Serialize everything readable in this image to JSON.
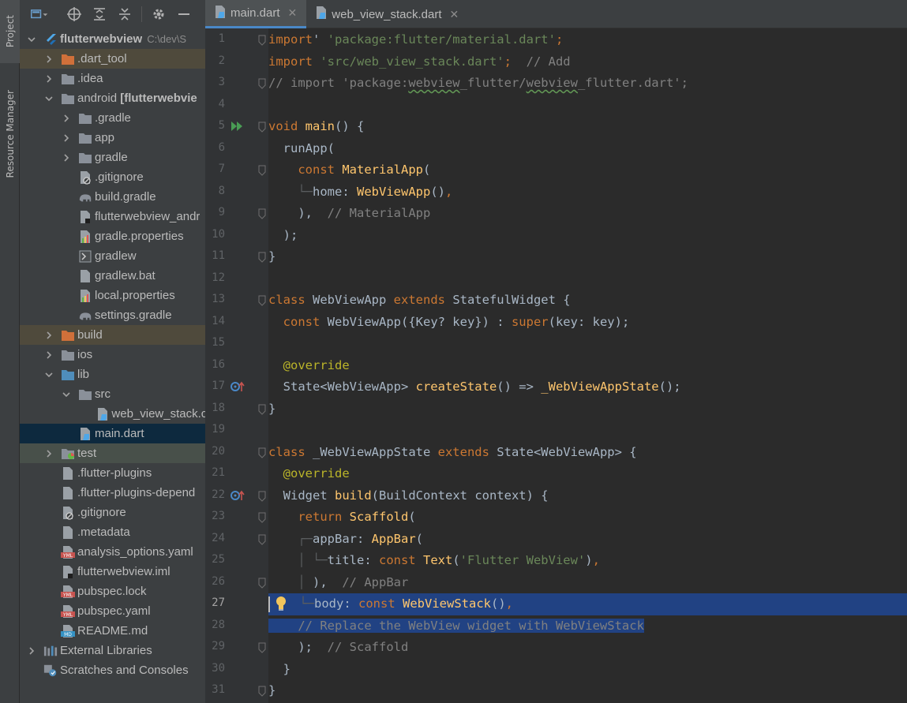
{
  "tool_strip": {
    "project_label": "Project",
    "resource_label": "Resource Manager"
  },
  "tree": [
    {
      "label": "flutterwebview",
      "hint": "C:\\dev\\S",
      "indent": 0,
      "arrow": "down",
      "icon": "flutter-module",
      "bold": true
    },
    {
      "label": ".dart_tool",
      "indent": 1,
      "arrow": "right",
      "icon": "folder-orange",
      "bg": "excluded"
    },
    {
      "label": ".idea",
      "indent": 1,
      "arrow": "right",
      "icon": "folder"
    },
    {
      "label": "android [flutterwebvie",
      "indent": 1,
      "arrow": "down",
      "icon": "folder",
      "bold_suffix": true
    },
    {
      "label": ".gradle",
      "indent": 2,
      "arrow": "right",
      "icon": "folder"
    },
    {
      "label": "app",
      "indent": 2,
      "arrow": "right",
      "icon": "folder"
    },
    {
      "label": "gradle",
      "indent": 2,
      "arrow": "right",
      "icon": "folder"
    },
    {
      "label": ".gitignore",
      "indent": 2,
      "arrow": "",
      "icon": "gitignore"
    },
    {
      "label": "build.gradle",
      "indent": 2,
      "arrow": "",
      "icon": "gradle-elephant"
    },
    {
      "label": "flutterwebview_andr",
      "indent": 2,
      "arrow": "",
      "icon": "file-dark"
    },
    {
      "label": "gradle.properties",
      "indent": 2,
      "arrow": "",
      "icon": "properties"
    },
    {
      "label": "gradlew",
      "indent": 2,
      "arrow": "",
      "icon": "shell"
    },
    {
      "label": "gradlew.bat",
      "indent": 2,
      "arrow": "",
      "icon": "file"
    },
    {
      "label": "local.properties",
      "indent": 2,
      "arrow": "",
      "icon": "properties"
    },
    {
      "label": "settings.gradle",
      "indent": 2,
      "arrow": "",
      "icon": "gradle-elephant"
    },
    {
      "label": "build",
      "indent": 1,
      "arrow": "right",
      "icon": "folder-orange",
      "bg": "excluded"
    },
    {
      "label": "ios",
      "indent": 1,
      "arrow": "right",
      "icon": "folder"
    },
    {
      "label": "lib",
      "indent": 1,
      "arrow": "down",
      "icon": "folder-blue"
    },
    {
      "label": "src",
      "indent": 2,
      "arrow": "down",
      "icon": "folder"
    },
    {
      "label": "web_view_stack.c",
      "indent": 3,
      "arrow": "",
      "icon": "dart"
    },
    {
      "label": "main.dart",
      "indent": 2,
      "arrow": "",
      "icon": "dart",
      "bg": "selected"
    },
    {
      "label": "test",
      "indent": 1,
      "arrow": "right",
      "icon": "folder-test",
      "bg": "test-bg"
    },
    {
      "label": ".flutter-plugins",
      "indent": 1,
      "arrow": "",
      "icon": "file"
    },
    {
      "label": ".flutter-plugins-depend",
      "indent": 1,
      "arrow": "",
      "icon": "file"
    },
    {
      "label": ".gitignore",
      "indent": 1,
      "arrow": "",
      "icon": "gitignore"
    },
    {
      "label": ".metadata",
      "indent": 1,
      "arrow": "",
      "icon": "file"
    },
    {
      "label": "analysis_options.yaml",
      "indent": 1,
      "arrow": "",
      "icon": "yml"
    },
    {
      "label": "flutterwebview.iml",
      "indent": 1,
      "arrow": "",
      "icon": "file-dark"
    },
    {
      "label": "pubspec.lock",
      "indent": 1,
      "arrow": "",
      "icon": "yml"
    },
    {
      "label": "pubspec.yaml",
      "indent": 1,
      "arrow": "",
      "icon": "yml"
    },
    {
      "label": "README.md",
      "indent": 1,
      "arrow": "",
      "icon": "md"
    },
    {
      "label": "External Libraries",
      "indent": 0,
      "arrow": "right",
      "icon": "libraries"
    },
    {
      "label": "Scratches and Consoles",
      "indent": 0,
      "arrow": "",
      "icon": "scratches"
    }
  ],
  "tabs": [
    {
      "label": "main.dart",
      "active": true
    },
    {
      "label": "web_view_stack.dart",
      "active": false
    }
  ],
  "code_lines": [
    {
      "n": "1",
      "fold": true,
      "tokens": [
        [
          "kw",
          "import"
        ],
        [
          "",
          "' "
        ],
        [
          "str",
          "'package:flutter/material.dart'"
        ],
        [
          "kw",
          ";"
        ]
      ]
    },
    {
      "n": "2",
      "tokens": [
        [
          "kw",
          "import "
        ],
        [
          "str",
          "'src/web_view_stack.dart'"
        ],
        [
          "kw",
          ";"
        ],
        [
          "cmt",
          "  // Add"
        ]
      ]
    },
    {
      "n": "3",
      "fold": true,
      "tokens": [
        [
          "cmt",
          "// import 'package:"
        ],
        [
          "cmt typo",
          "webview"
        ],
        [
          "cmt",
          "_flutter/"
        ],
        [
          "cmt typo",
          "webview"
        ],
        [
          "cmt",
          "_flutter.dart';"
        ]
      ]
    },
    {
      "n": "4",
      "tokens": []
    },
    {
      "n": "5",
      "fold": true,
      "mark": "run",
      "tokens": [
        [
          "kw",
          "void "
        ],
        [
          "fn",
          "main"
        ],
        [
          "",
          "() {"
        ]
      ]
    },
    {
      "n": "6",
      "tokens": [
        [
          "",
          "  runApp("
        ]
      ]
    },
    {
      "n": "7",
      "fold": true,
      "tokens": [
        [
          "",
          "    "
        ],
        [
          "kw",
          "const "
        ],
        [
          "fn",
          "MaterialApp"
        ],
        [
          "",
          "("
        ]
      ]
    },
    {
      "n": "8",
      "tokens": [
        [
          "guide",
          "    └─"
        ],
        [
          "",
          "home: "
        ],
        [
          "fn",
          "WebViewApp"
        ],
        [
          "",
          "()"
        ],
        [
          "kw",
          ","
        ]
      ]
    },
    {
      "n": "9",
      "fold": true,
      "tokens": [
        [
          "",
          "    ),"
        ],
        [
          "cmt",
          "  // MaterialApp"
        ]
      ]
    },
    {
      "n": "10",
      "tokens": [
        [
          "",
          "  );"
        ]
      ]
    },
    {
      "n": "11",
      "fold": true,
      "tokens": [
        [
          "",
          "}"
        ]
      ]
    },
    {
      "n": "12",
      "tokens": []
    },
    {
      "n": "13",
      "fold": true,
      "tokens": [
        [
          "kw",
          "class "
        ],
        [
          "",
          "WebViewApp "
        ],
        [
          "kw",
          "extends "
        ],
        [
          "",
          "StatefulWidget {"
        ]
      ]
    },
    {
      "n": "14",
      "tokens": [
        [
          "",
          "  "
        ],
        [
          "kw",
          "const "
        ],
        [
          "",
          "WebViewApp({Key? key}) : "
        ],
        [
          "kw",
          "super"
        ],
        [
          "",
          "(key: key);"
        ]
      ]
    },
    {
      "n": "15",
      "tokens": []
    },
    {
      "n": "16",
      "tokens": [
        [
          "",
          "  "
        ],
        [
          "ann",
          "@override"
        ]
      ]
    },
    {
      "n": "17",
      "mark": "override",
      "tokens": [
        [
          "",
          "  State<WebViewApp> "
        ],
        [
          "fn",
          "createState"
        ],
        [
          "",
          "() => "
        ],
        [
          "fn",
          "_WebViewAppState"
        ],
        [
          "",
          "();"
        ]
      ]
    },
    {
      "n": "18",
      "fold": true,
      "tokens": [
        [
          "",
          "}"
        ]
      ]
    },
    {
      "n": "19",
      "tokens": []
    },
    {
      "n": "20",
      "fold": true,
      "tokens": [
        [
          "kw",
          "class "
        ],
        [
          "",
          "_WebViewAppState "
        ],
        [
          "kw",
          "extends "
        ],
        [
          "",
          "State<WebViewApp> {"
        ]
      ]
    },
    {
      "n": "21",
      "tokens": [
        [
          "",
          "  "
        ],
        [
          "ann",
          "@override"
        ]
      ]
    },
    {
      "n": "22",
      "mark": "override",
      "fold": true,
      "tokens": [
        [
          "",
          "  Widget "
        ],
        [
          "fn",
          "build"
        ],
        [
          "",
          "(BuildContext context) {"
        ]
      ]
    },
    {
      "n": "23",
      "fold": true,
      "tokens": [
        [
          "",
          "    "
        ],
        [
          "kw",
          "return "
        ],
        [
          "fn",
          "Scaffold"
        ],
        [
          "",
          "("
        ]
      ]
    },
    {
      "n": "24",
      "fold": true,
      "tokens": [
        [
          "guide",
          "    ┌─"
        ],
        [
          "",
          "appBar: "
        ],
        [
          "fn",
          "AppBar"
        ],
        [
          "",
          "("
        ]
      ]
    },
    {
      "n": "25",
      "tokens": [
        [
          "guide",
          "    │ └─"
        ],
        [
          "",
          "title: "
        ],
        [
          "kw",
          "const "
        ],
        [
          "fn",
          "Text"
        ],
        [
          "",
          "("
        ],
        [
          "str",
          "'Flutter WebView'"
        ],
        [
          "",
          ")"
        ],
        [
          "kw",
          ","
        ]
      ]
    },
    {
      "n": "26",
      "fold": true,
      "tokens": [
        [
          "guide",
          "    │ "
        ],
        [
          "",
          "),"
        ],
        [
          "cmt",
          "  // AppBar"
        ]
      ]
    },
    {
      "n": "27",
      "selected": true,
      "tokens": [
        [
          "guide",
          "    └─"
        ],
        [
          "",
          "body: "
        ],
        [
          "kw",
          "const "
        ],
        [
          "fn",
          "WebViewStack"
        ],
        [
          "",
          "()"
        ],
        [
          "kw",
          ","
        ]
      ]
    },
    {
      "n": "28",
      "partial": true,
      "tokens": [
        [
          "cmt",
          "    // Replace the WebView widget with WebViewStack"
        ]
      ]
    },
    {
      "n": "29",
      "fold": true,
      "tokens": [
        [
          "",
          "    );"
        ],
        [
          "cmt",
          "  // Scaffold"
        ]
      ]
    },
    {
      "n": "30",
      "tokens": [
        [
          "",
          "  }"
        ]
      ]
    },
    {
      "n": "31",
      "fold": true,
      "tokens": [
        [
          "",
          "}"
        ]
      ]
    }
  ],
  "colors": {
    "accent": "#4a88c7",
    "selection": "#214283",
    "keyword": "#cc7832",
    "string": "#6a8759",
    "function": "#ffc66d",
    "comment": "#808080"
  }
}
